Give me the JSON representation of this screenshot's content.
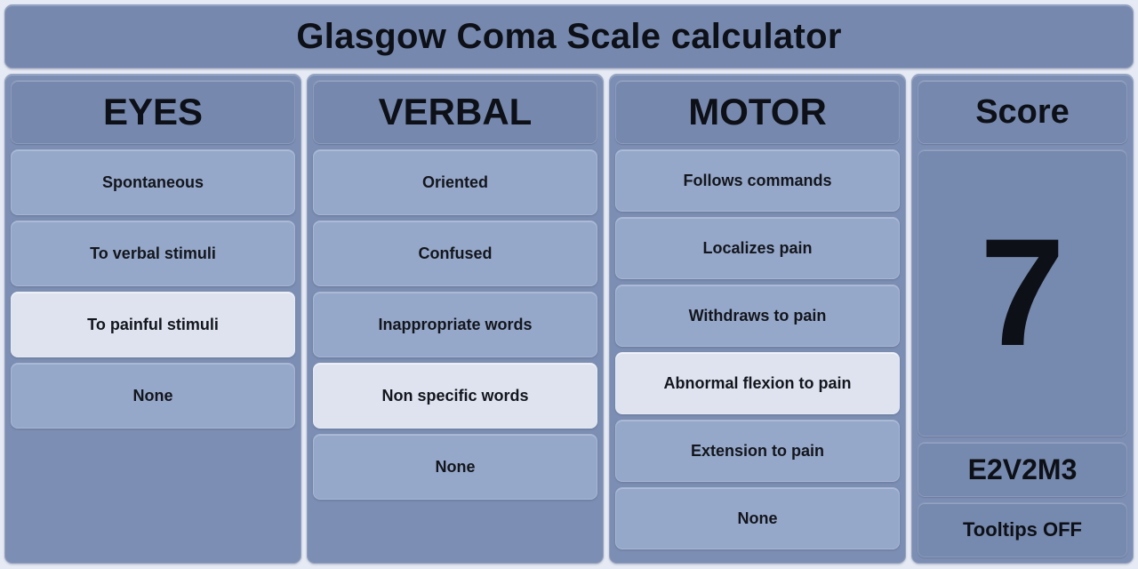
{
  "app": {
    "title": "Glasgow Coma Scale calculator",
    "background_color": "#e6eaf4",
    "panel_color": "#7c8eb3",
    "header_color": "#7688ae",
    "option_color": "#96a8ca",
    "selected_color": "#dee3ef",
    "text_color": "#0d1016"
  },
  "columns": {
    "eyes": {
      "header": "EYES",
      "options": [
        {
          "label": "Spontaneous",
          "selected": false
        },
        {
          "label": "To verbal stimuli",
          "selected": false
        },
        {
          "label": "To painful stimuli",
          "selected": true
        },
        {
          "label": "None",
          "selected": false
        }
      ]
    },
    "verbal": {
      "header": "VERBAL",
      "options": [
        {
          "label": "Oriented",
          "selected": false
        },
        {
          "label": "Confused",
          "selected": false
        },
        {
          "label": "Inappropriate words",
          "selected": false
        },
        {
          "label": "Non specific words",
          "selected": true
        },
        {
          "label": "None",
          "selected": false
        }
      ]
    },
    "motor": {
      "header": "MOTOR",
      "options": [
        {
          "label": "Follows commands",
          "selected": false
        },
        {
          "label": "Localizes pain",
          "selected": false
        },
        {
          "label": "Withdraws to pain",
          "selected": false
        },
        {
          "label": "Abnormal flexion to pain",
          "selected": true
        },
        {
          "label": "Extension to pain",
          "selected": false
        },
        {
          "label": "None",
          "selected": false
        }
      ]
    },
    "score": {
      "header": "Score",
      "total": "7",
      "breakdown": "E2V2M3",
      "tooltips": "Tooltips OFF"
    }
  }
}
